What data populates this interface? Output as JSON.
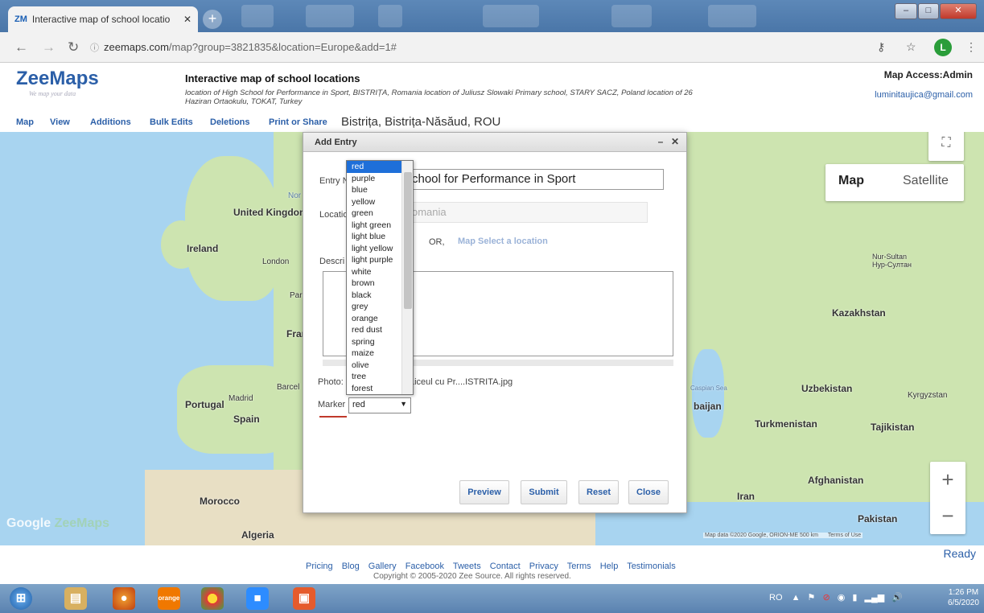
{
  "browser": {
    "tab_title": "Interactive map of school locatio",
    "favicon_text": "ZM",
    "url_host": "zeemaps.com",
    "url_rest": "/map?group=3821835&location=Europe&add=1#"
  },
  "header": {
    "logo": "ZeeMaps",
    "tagline": "We map your data",
    "title": "Interactive map of school locations",
    "description": "location of High School for Performance in Sport, BISTRIȚA, Romania location of Juliusz Slowaki Primary school, STARY SACZ, Poland location of 26 Haziran Ortaokulu, TOKAT, Turkey",
    "access": "Map Access:Admin",
    "email": "luminitaujica@gmail.com"
  },
  "menu": {
    "items": [
      "Map",
      "View",
      "Additions",
      "Bulk Edits",
      "Deletions",
      "Print or Share"
    ],
    "location_text": "Bistrița, Bistrița-Năsăud, ROU"
  },
  "map": {
    "type_map": "Map",
    "type_satellite": "Satellite",
    "labels": [
      "United Kingdom",
      "Ireland",
      "London",
      "Pari",
      "Fran",
      "Portugal",
      "Madrid",
      "Spain",
      "Barcel",
      "Morocco",
      "Algeria",
      "Kazakhstan",
      "Nur-Sultan Нур-Султан",
      "Uzbekistan",
      "Kyrgyzstan",
      "Turkmenistan",
      "Tajikistan",
      "Afghanistan",
      "Iran",
      "Pakistan",
      "baijan",
      "Caspian Sea",
      "Nor"
    ],
    "google": "Google",
    "zeemaps_watermark": "ZeeMaps",
    "attribution": "Map data ©2020 Google, ORION-ME   500 km",
    "terms": "Terms of Use",
    "zoom_in": "+",
    "zoom_out": "−"
  },
  "dialog": {
    "title": "Add Entry",
    "entry_name_label": "Entry N",
    "entry_name_value": "chool for Performance in Sport",
    "location_label": "Locatio",
    "location_value": "omania",
    "or_text": "OR,",
    "map_select": "Map Select a location",
    "description_label": "Descri",
    "photo_label": "Photo:",
    "photo_value": "Liceul cu Pr....ISTRITA.jpg",
    "marker_label": "Marker",
    "marker_value": "red",
    "buttons": [
      "Preview",
      "Submit",
      "Reset",
      "Close"
    ]
  },
  "dropdown": {
    "options": [
      "red",
      "purple",
      "blue",
      "yellow",
      "green",
      "light green",
      "light blue",
      "light yellow",
      "light purple",
      "white",
      "brown",
      "black",
      "grey",
      "orange",
      "red dust",
      "spring",
      "maize",
      "olive",
      "tree",
      "forest"
    ],
    "selected": "red"
  },
  "footer": {
    "status": "Ready",
    "links": [
      "Pricing",
      "Blog",
      "Gallery",
      "Facebook",
      "Tweets",
      "Contact",
      "Privacy",
      "Terms",
      "Help",
      "Testimonials"
    ],
    "copyright": "Copyright © 2005-2020 Zee Source. All rights reserved."
  },
  "taskbar": {
    "tray_lang": "RO",
    "time": "1:26 PM",
    "date": "6/5/2020"
  }
}
